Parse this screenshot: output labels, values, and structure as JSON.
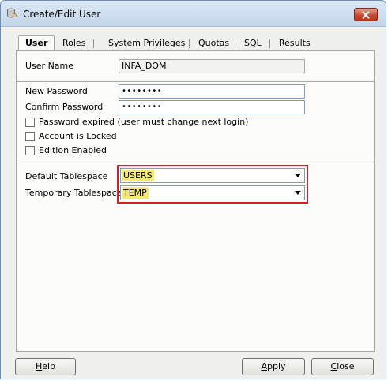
{
  "window": {
    "title": "Create/Edit User"
  },
  "tabs": [
    {
      "label": "User",
      "active": true
    },
    {
      "label": "Roles"
    },
    {
      "label": "System Privileges"
    },
    {
      "label": "Quotas"
    },
    {
      "label": "SQL"
    },
    {
      "label": "Results"
    }
  ],
  "user_tab": {
    "user_name_label": "User Name",
    "user_name_value": "INFA_DOM",
    "new_password_label": "New Password",
    "new_password_value": "••••••••",
    "confirm_password_label": "Confirm Password",
    "confirm_password_value": "••••••••",
    "checkboxes": [
      {
        "label": "Password expired (user must change next login)",
        "checked": false
      },
      {
        "label": "Account is Locked",
        "checked": false
      },
      {
        "label": "Edition Enabled",
        "checked": false
      }
    ],
    "default_tablespace_label": "Default Tablespace",
    "default_tablespace_value": "USERS",
    "temporary_tablespace_label": "Temporary Tablespace",
    "temporary_tablespace_value": "TEMP"
  },
  "buttons": {
    "help": {
      "mnemonic": "H",
      "rest": "elp"
    },
    "apply": {
      "mnemonic": "A",
      "rest": "pply"
    },
    "close": {
      "mnemonic": "C",
      "rest": "lose"
    }
  },
  "colors": {
    "highlight_border": "#d61f26",
    "selection_highlight": "#f5e87a",
    "close_button": "#c94a34"
  }
}
